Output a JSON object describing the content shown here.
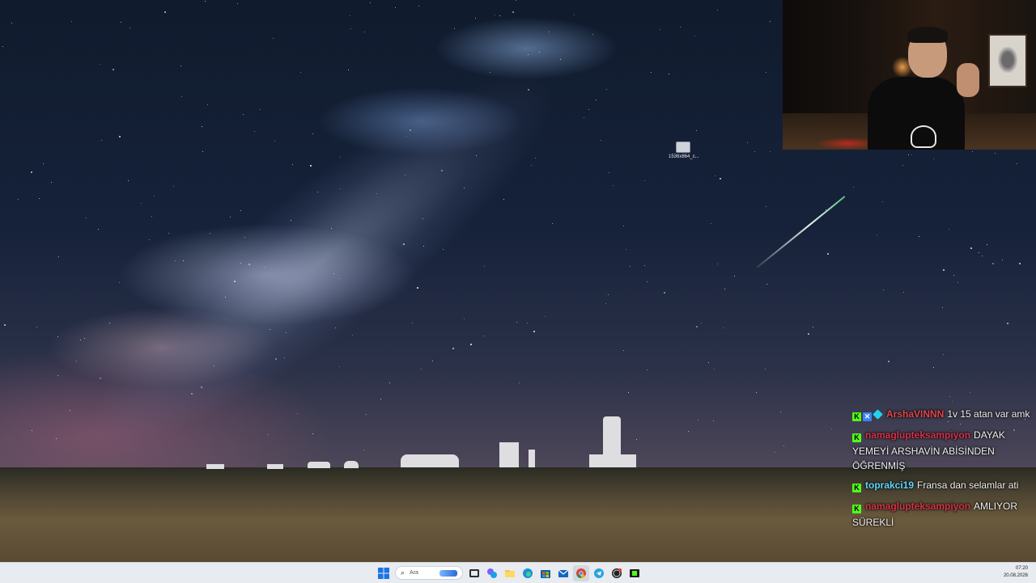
{
  "desktop": {
    "icon_label": "1536x864_c..."
  },
  "chat": {
    "messages": [
      {
        "badges": [
          "kick-badge",
          "subscriber-badge",
          "gem-badge"
        ],
        "username": "ArshaVINNN",
        "user_color": "#e0474c",
        "text": "1v 15 atan var amk"
      },
      {
        "badges": [
          "kick-badge"
        ],
        "username": "namaglupteksampiyon",
        "user_color": "#d8324a",
        "text": "DAYAK YEMEYİ ARSHAVİN ABİSİNDEN ÖĞRENMİŞ"
      },
      {
        "badges": [
          "kick-badge"
        ],
        "username": "toprakci19",
        "user_color": "#5fd8ff",
        "text": "Fransa dan selamlar ati"
      },
      {
        "badges": [
          "kick-badge"
        ],
        "username": "namaglupteksampiyon",
        "user_color": "#d8324a",
        "text": "AMLIYOR SÜREKLİ"
      }
    ]
  },
  "taskbar": {
    "search_placeholder": "Ara",
    "pinned": [
      "windows-start-icon",
      "task-view-icon",
      "copilot-icon",
      "file-explorer-icon",
      "edge-icon",
      "store-icon",
      "mail-icon",
      "chrome-icon",
      "telegram-icon",
      "obs-icon",
      "kick-icon"
    ],
    "clock": {
      "time": "07:20",
      "date": "20.08.2026"
    }
  },
  "colors": {
    "kick_green": "#53fc18",
    "taskbar_bg": "#e8ebf0"
  }
}
